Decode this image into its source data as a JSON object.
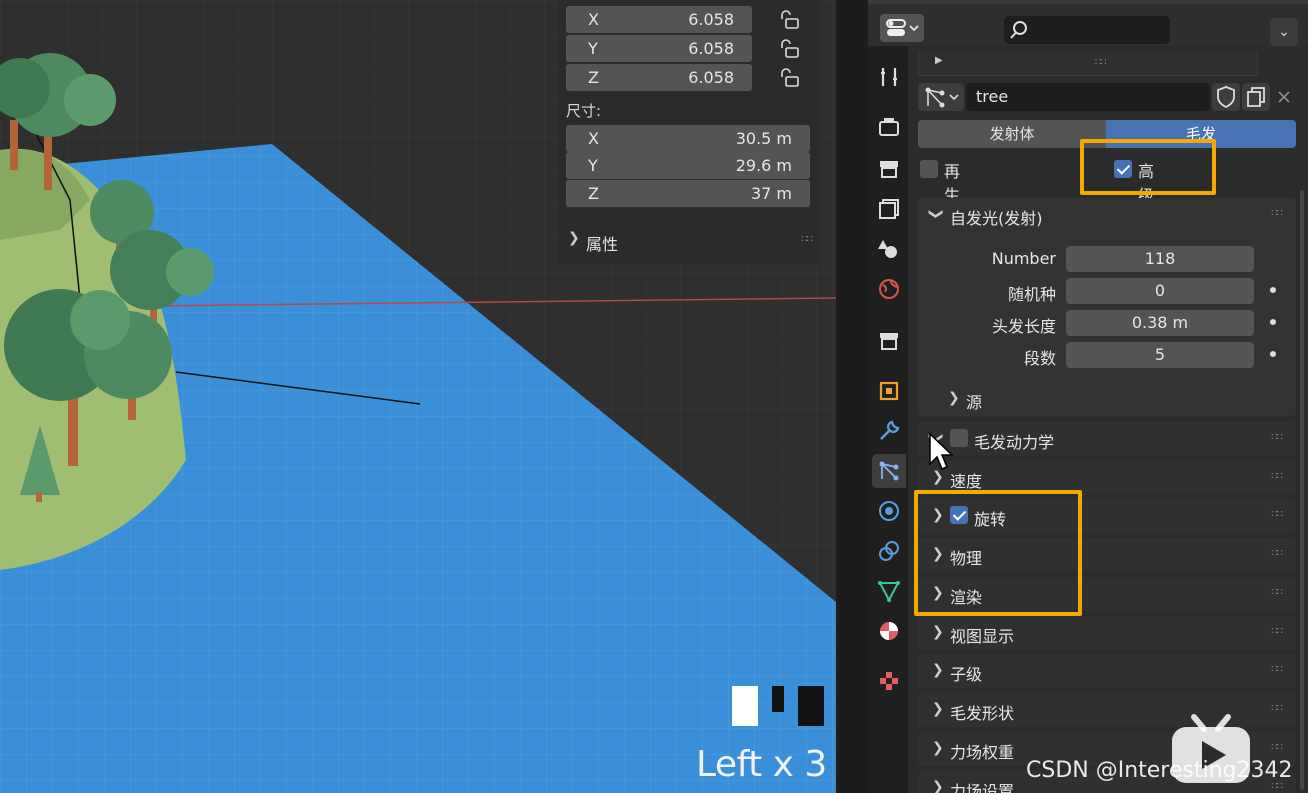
{
  "viewport": {
    "scale": [
      {
        "axis": "X",
        "value": "6.058"
      },
      {
        "axis": "Y",
        "value": "6.058"
      },
      {
        "axis": "Z",
        "value": "6.058"
      }
    ],
    "dimensions_title": "尺寸:",
    "dimensions": [
      {
        "axis": "X",
        "value": "30.5 m"
      },
      {
        "axis": "Y",
        "value": "29.6 m"
      },
      {
        "axis": "Z",
        "value": "37 m"
      }
    ],
    "properties_label": "属性",
    "operator_overlay": "Left x 3"
  },
  "properties": {
    "particle_system_name": "tree",
    "type_tabs": [
      "发射体",
      "毛发"
    ],
    "active_type": "毛发",
    "regrow_label": "再生",
    "regrow_checked": false,
    "advanced_label": "高级",
    "advanced_checked": true,
    "emission": {
      "title": "自发光(发射)",
      "fields": [
        {
          "label": "Number",
          "value": "118"
        },
        {
          "label": "随机种",
          "value": "0"
        },
        {
          "label": "头发长度",
          "value": "0.38 m"
        },
        {
          "label": "段数",
          "value": "5"
        }
      ],
      "source_label": "源"
    },
    "hair_dynamics_label": "毛发动力学",
    "panels": [
      "速度",
      "旋转",
      "物理",
      "渲染",
      "视图显示",
      "子级",
      "毛发形状",
      "力场权重",
      "力场设置"
    ],
    "rotation_checked": true
  },
  "watermark": "CSDN @Interesting2342",
  "colors": {
    "accent": "#4772b3",
    "highlight": "#f5a800",
    "plane": "#3a8fd8"
  }
}
